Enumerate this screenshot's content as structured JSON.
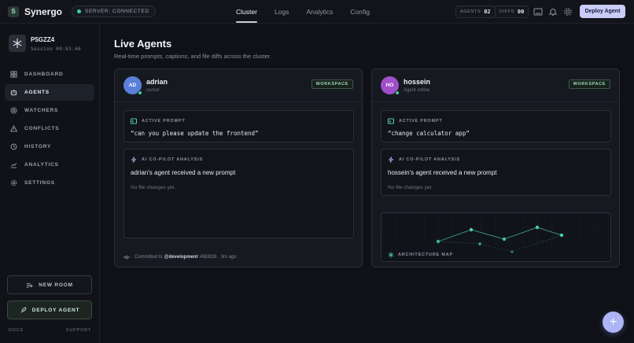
{
  "app": {
    "logo_letter": "S",
    "name": "Synergo",
    "server_status": "SERVER: CONNECTED"
  },
  "nav": {
    "items": [
      {
        "label": "Cluster",
        "active": true
      },
      {
        "label": "Logs",
        "active": false
      },
      {
        "label": "Analytics",
        "active": false
      },
      {
        "label": "Config",
        "active": false
      }
    ]
  },
  "counters": {
    "agents_label": "AGENTS",
    "agents_value": "02",
    "diffs_label": "DIFFS",
    "diffs_value": "00"
  },
  "top_actions": {
    "deploy_label": "Deploy Agent"
  },
  "session": {
    "id": "P5GZZ4",
    "time": "Session 00:03:46"
  },
  "sidebar": {
    "items": [
      {
        "label": "DASHBOARD",
        "icon": "dashboard-icon"
      },
      {
        "label": "AGENTS",
        "icon": "agents-icon",
        "active": true
      },
      {
        "label": "WATCHERS",
        "icon": "watchers-icon"
      },
      {
        "label": "CONFLICTS",
        "icon": "conflicts-icon"
      },
      {
        "label": "HISTORY",
        "icon": "history-icon"
      },
      {
        "label": "ANALYTICS",
        "icon": "analytics-icon"
      },
      {
        "label": "SETTINGS",
        "icon": "settings-icon"
      }
    ],
    "new_room_label": "NEW ROOM",
    "deploy_label": "DEPLOY AGENT",
    "docs_label": "DOCS",
    "support_label": "SUPPORT"
  },
  "main": {
    "title": "Live Agents",
    "subtitle": "Real-time prompts, captions, and file diffs across the cluster."
  },
  "agents": [
    {
      "initials": "AD",
      "name": "adrian",
      "status": "cursor",
      "badge": "WORKSPACE",
      "prompt_label": "ACTIVE PROMPT",
      "prompt": "“can you please update the frontend”",
      "analysis_label": "AI CO-PILOT ANALYSIS",
      "analysis_title": "adrian's agent received a new prompt",
      "analysis_note": "No file changes yet.",
      "commit_prefix": "Committed to",
      "commit_branch": "@development",
      "commit_hash": "#663f28 · 3m ago",
      "avatar_color": "#5b7fd9"
    },
    {
      "initials": "HO",
      "name": "hossein",
      "status": "Agent online",
      "badge": "WORKSPACE",
      "prompt_label": "ACTIVE PROMPT",
      "prompt": "“change calculator app”",
      "analysis_label": "AI CO-PILOT ANALYSIS",
      "analysis_title": "hossein's agent received a new prompt",
      "analysis_note": "No file changes yet.",
      "map_label": "ARCHITECTURE MAP",
      "avatar_color": "#a04fc9"
    }
  ],
  "colors": {
    "accent": "#c9ccf7",
    "online": "#38d39f",
    "map_node": "#4fd1a8"
  }
}
